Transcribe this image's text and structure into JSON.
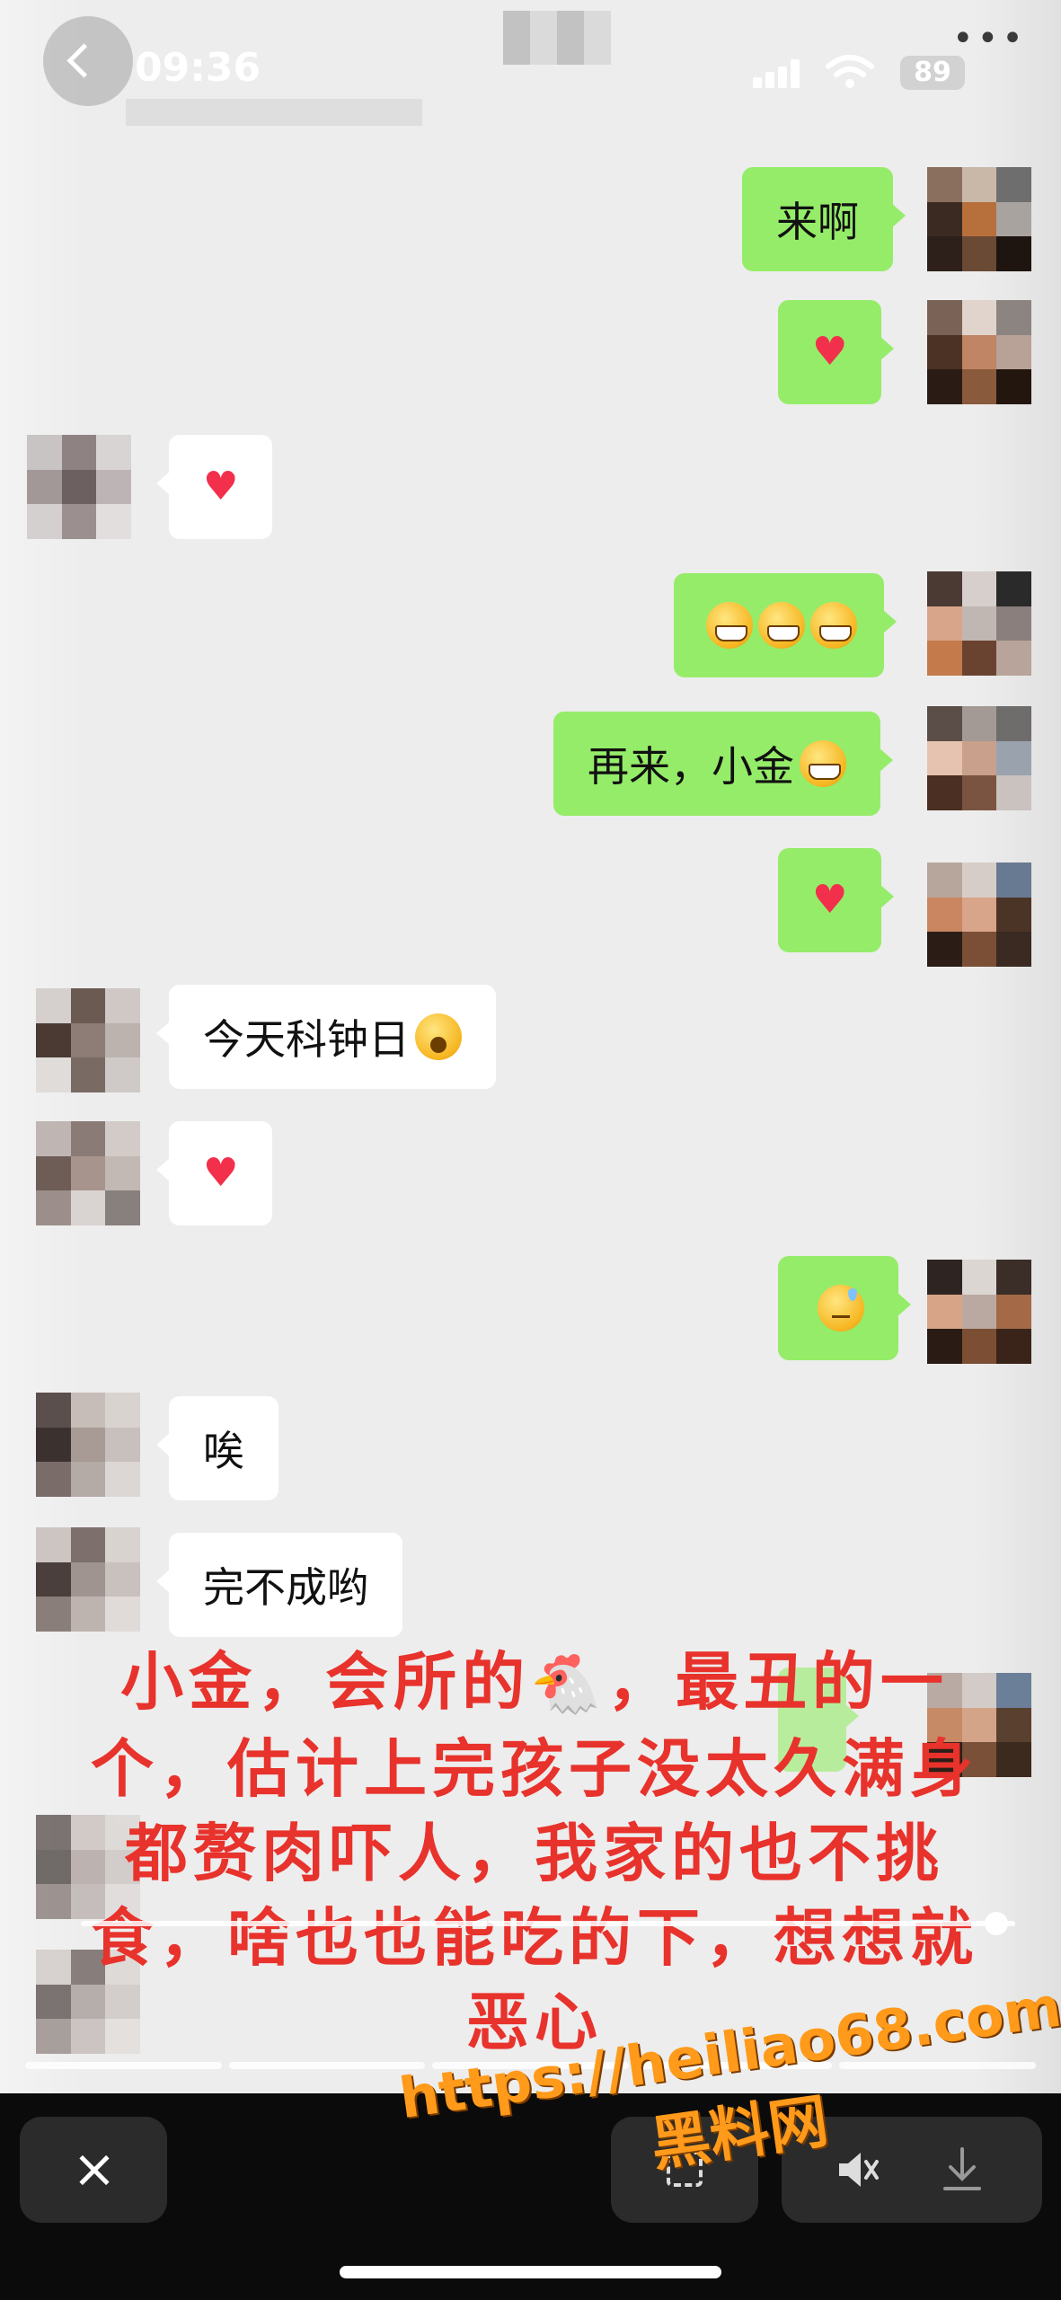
{
  "status_bar": {
    "time": "09:36",
    "battery": "89"
  },
  "messages": [
    {
      "side": "out",
      "text": "来啊",
      "emoji": ""
    },
    {
      "side": "out",
      "text": "",
      "emoji": "heart"
    },
    {
      "side": "in",
      "text": "",
      "emoji": "heart"
    },
    {
      "side": "out",
      "text": "",
      "emoji": "grin x3"
    },
    {
      "side": "out",
      "text": "再来，小金",
      "emoji": "grin"
    },
    {
      "side": "out",
      "text": "",
      "emoji": "heart"
    },
    {
      "side": "in",
      "text": "今天科钟日",
      "emoji": "scream"
    },
    {
      "side": "in",
      "text": "",
      "emoji": "heart"
    },
    {
      "side": "out",
      "text": "",
      "emoji": "sweat"
    },
    {
      "side": "in",
      "text": "唉",
      "emoji": ""
    },
    {
      "side": "in",
      "text": "完不成哟",
      "emoji": ""
    }
  ],
  "overlay": {
    "part1": "小金，会所的",
    "chicken": "🐔",
    "part2": "，最丑的一个，估计上完孩子没太久满身都赘肉吓人，我家的也不挑食，啥也也能吃的下，想想就恶心"
  },
  "video": {
    "progress_fraction": 0.98
  },
  "watermark": {
    "url": "https://heiliao68.com",
    "name": "黑料网"
  },
  "icons": [
    "back-icon",
    "signal-icon",
    "wifi-icon",
    "more-icon",
    "close-icon",
    "scan-icon",
    "mute-icon",
    "download-icon"
  ],
  "colors": {
    "incoming": "#ffffff",
    "outgoing": "#95ec69",
    "overlay_text": "#e8322c",
    "watermark": "#ff9a1a"
  }
}
